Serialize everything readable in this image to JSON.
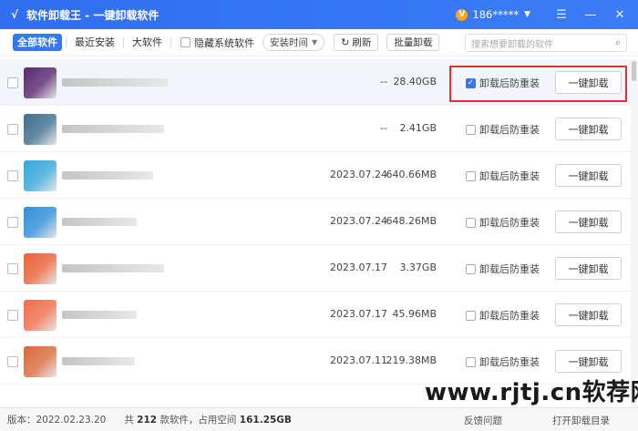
{
  "title_bar": {
    "app_title": "软件卸载王 - 一键卸载软件",
    "account": "186*****",
    "logo_glyph": "√",
    "vip_glyph": "V"
  },
  "toolbar": {
    "tabs": [
      {
        "label": "全部软件",
        "active": true
      },
      {
        "label": "最近安装",
        "active": false
      },
      {
        "label": "大软件",
        "active": false
      }
    ],
    "hide_system_label": "隐藏系统软件",
    "sort_label": "安装时间",
    "refresh_label": "刷新",
    "batch_uninstall_label": "批量卸载",
    "search_placeholder": "搜索想要卸载的软件"
  },
  "list": {
    "prevent_label": "卸载后防重装",
    "uninstall_label": "一键卸载",
    "rows": [
      {
        "date": "--",
        "size": "28.40GB",
        "prevent_checked": true,
        "selected": true,
        "icon_color": "#5a2a6e",
        "name_width": 116
      },
      {
        "date": "--",
        "size": "2.41GB",
        "prevent_checked": false,
        "selected": false,
        "icon_color": "#3f6f8e",
        "name_width": 112
      },
      {
        "date": "2023.07.24",
        "size": "640.66MB",
        "prevent_checked": false,
        "selected": false,
        "icon_color": "#35a7d8",
        "name_width": 100
      },
      {
        "date": "2023.07.24",
        "size": "648.26MB",
        "prevent_checked": false,
        "selected": false,
        "icon_color": "#2f8fd8",
        "name_width": 82
      },
      {
        "date": "2023.07.17",
        "size": "3.37GB",
        "prevent_checked": false,
        "selected": false,
        "icon_color": "#e8643a",
        "name_width": 112
      },
      {
        "date": "2023.07.17",
        "size": "45.96MB",
        "prevent_checked": false,
        "selected": false,
        "icon_color": "#ef6e4c",
        "name_width": 82
      },
      {
        "date": "2023.07.11",
        "size": "219.38MB",
        "prevent_checked": false,
        "selected": false,
        "icon_color": "#d96a3a",
        "name_width": 80
      }
    ]
  },
  "status_bar": {
    "version": "版本：2022.02.23.20",
    "total_prefix": "共",
    "total_count": "212",
    "total_middle": "款软件，占用空间",
    "total_space": "161.25GB",
    "feedback_label": "反馈问题",
    "open_dir_label": "打开卸载目录"
  },
  "watermark": {
    "text": "www.rjtj.cn软荐网"
  }
}
